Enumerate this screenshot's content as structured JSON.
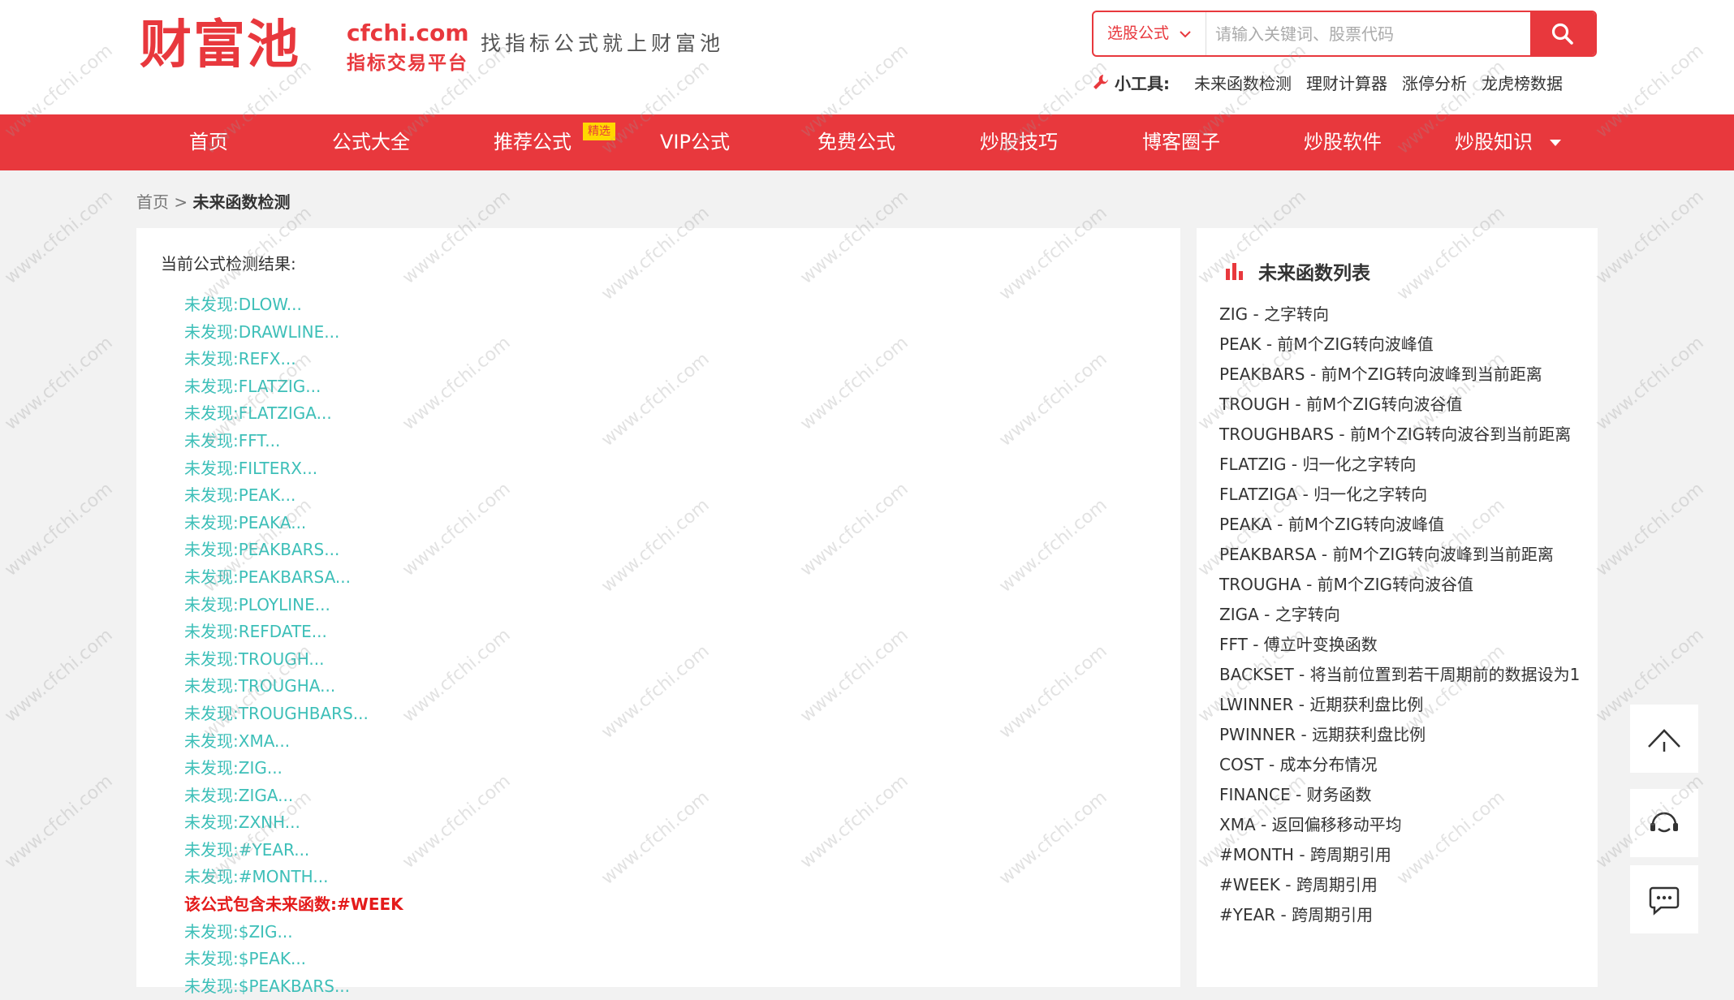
{
  "header": {
    "logo_text": "财富池",
    "logo_domain": "cfchi.com",
    "logo_sub": "指标交易平台",
    "slogan": "找指标公式就上财富池",
    "search": {
      "select_label": "选股公式",
      "placeholder": "请输入关键词、股票代码"
    },
    "tools": {
      "label": "小工具:",
      "links": [
        "未来函数检测",
        "理财计算器",
        "涨停分析",
        "龙虎榜数据"
      ]
    }
  },
  "nav": {
    "items": [
      "首页",
      "公式大全",
      "推荐公式",
      "VIP公式",
      "免费公式",
      "炒股技巧",
      "博客圈子",
      "炒股软件",
      "炒股知识"
    ],
    "badge": "精选"
  },
  "breadcrumb": {
    "home": "首页",
    "sep": ">",
    "current": "未来函数检测"
  },
  "main": {
    "title": "当前公式检测结果:",
    "results": [
      "未发现:DLOW...",
      "未发现:DRAWLINE...",
      "未发现:REFX...",
      "未发现:FLATZIG...",
      "未发现:FLATZIGA...",
      "未发现:FFT...",
      "未发现:FILTERX...",
      "未发现:PEAK...",
      "未发现:PEAKA...",
      "未发现:PEAKBARS...",
      "未发现:PEAKBARSA...",
      "未发现:PLOYLINE...",
      "未发现:REFDATE...",
      "未发现:TROUGH...",
      "未发现:TROUGHA...",
      "未发现:TROUGHBARS...",
      "未发现:XMA...",
      "未发现:ZIG...",
      "未发现:ZIGA...",
      "未发现:ZXNH...",
      "未发现:#YEAR...",
      "未发现:#MONTH...",
      "该公式包含未来函数:#WEEK",
      "未发现:$ZIG...",
      "未发现:$PEAK...",
      "未发现:$PEAKBARS..."
    ],
    "found_index": 22
  },
  "side": {
    "title": "未来函数列表",
    "items": [
      "ZIG - 之字转向",
      "PEAK - 前M个ZIG转向波峰值",
      "PEAKBARS - 前M个ZIG转向波峰到当前距离",
      "TROUGH - 前M个ZIG转向波谷值",
      "TROUGHBARS - 前M个ZIG转向波谷到当前距离",
      "FLATZIG - 归一化之字转向",
      "FLATZIGA - 归一化之字转向",
      "PEAKA - 前M个ZIG转向波峰值",
      "PEAKBARSA - 前M个ZIG转向波峰到当前距离",
      "TROUGHA - 前M个ZIG转向波谷值",
      "ZIGA - 之字转向",
      "FFT - 傅立叶变换函数",
      "BACKSET - 将当前位置到若干周期前的数据设为1",
      "LWINNER - 近期获利盘比例",
      "PWINNER - 远期获利盘比例",
      "COST - 成本分布情况",
      "FINANCE - 财务函数",
      "XMA - 返回偏移移动平均",
      "#MONTH - 跨周期引用",
      "#WEEK - 跨周期引用",
      "#YEAR - 跨周期引用"
    ]
  },
  "watermark": "www.cfchi.com",
  "colors": {
    "accent": "#e8383d",
    "result_ok": "#3dbfb8",
    "result_found": "#e41b1b",
    "badge": "#ffd800"
  },
  "icons": [
    "search-icon",
    "chevron-down-icon",
    "wrench-icon",
    "caret-down-icon",
    "bar-chart-icon",
    "arrow-up-icon",
    "customer-service-icon",
    "chat-icon"
  ]
}
